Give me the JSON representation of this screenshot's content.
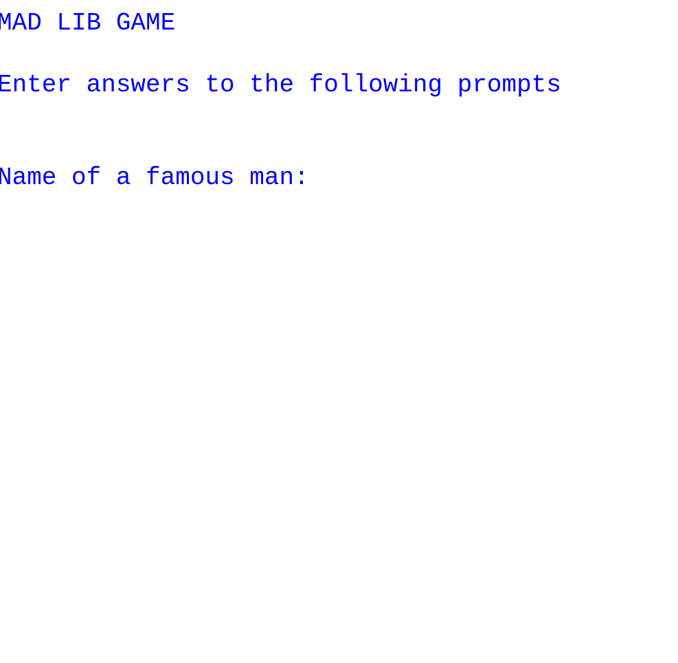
{
  "console": {
    "lines": [
      "MAD LIB GAME",
      "Enter answers to the following prompts",
      ""
    ],
    "prompt": "Name of a famous man: ",
    "input_value": ""
  }
}
